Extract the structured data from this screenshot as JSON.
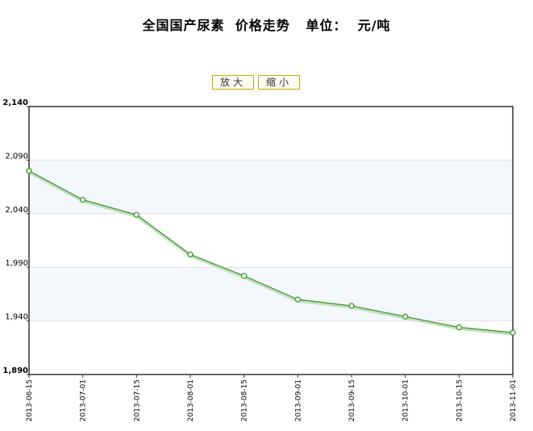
{
  "page": {
    "title_main": "全国国产尿素  价格走势",
    "title_unit_label": "单位：",
    "title_unit": "元/吨"
  },
  "controls": {
    "zoom_in_label": "放大",
    "zoom_out_label": "缩小"
  },
  "colors": {
    "line": "#3a9a2a",
    "band": "#f4f8fd",
    "axis": "#333333",
    "grid": "#e2e2e2"
  },
  "chart_data": {
    "type": "line",
    "title": "全国国产尿素  价格走势  单位：  元/吨",
    "x": [
      "2013-06-15",
      "2013-07-01",
      "2013-07-15",
      "2013-08-01",
      "2013-08-15",
      "2013-09-01",
      "2013-09-15",
      "2013-10-01",
      "2013-10-15",
      "2013-11-01"
    ],
    "series": [
      {
        "values": [
          2080,
          2053,
          2039,
          2002,
          1982,
          1960,
          1954,
          1944,
          1934,
          1929
        ]
      }
    ],
    "ylim": [
      1890,
      2140
    ],
    "yticks": [
      1890,
      1940,
      1990,
      2040,
      2090,
      2140
    ],
    "ytick_labels": [
      "1,890",
      "1,940",
      "1,990",
      "2,040",
      "2,090",
      "2,140"
    ],
    "xlabel": "",
    "ylabel": "",
    "grid": true,
    "alternating_bands": true
  }
}
